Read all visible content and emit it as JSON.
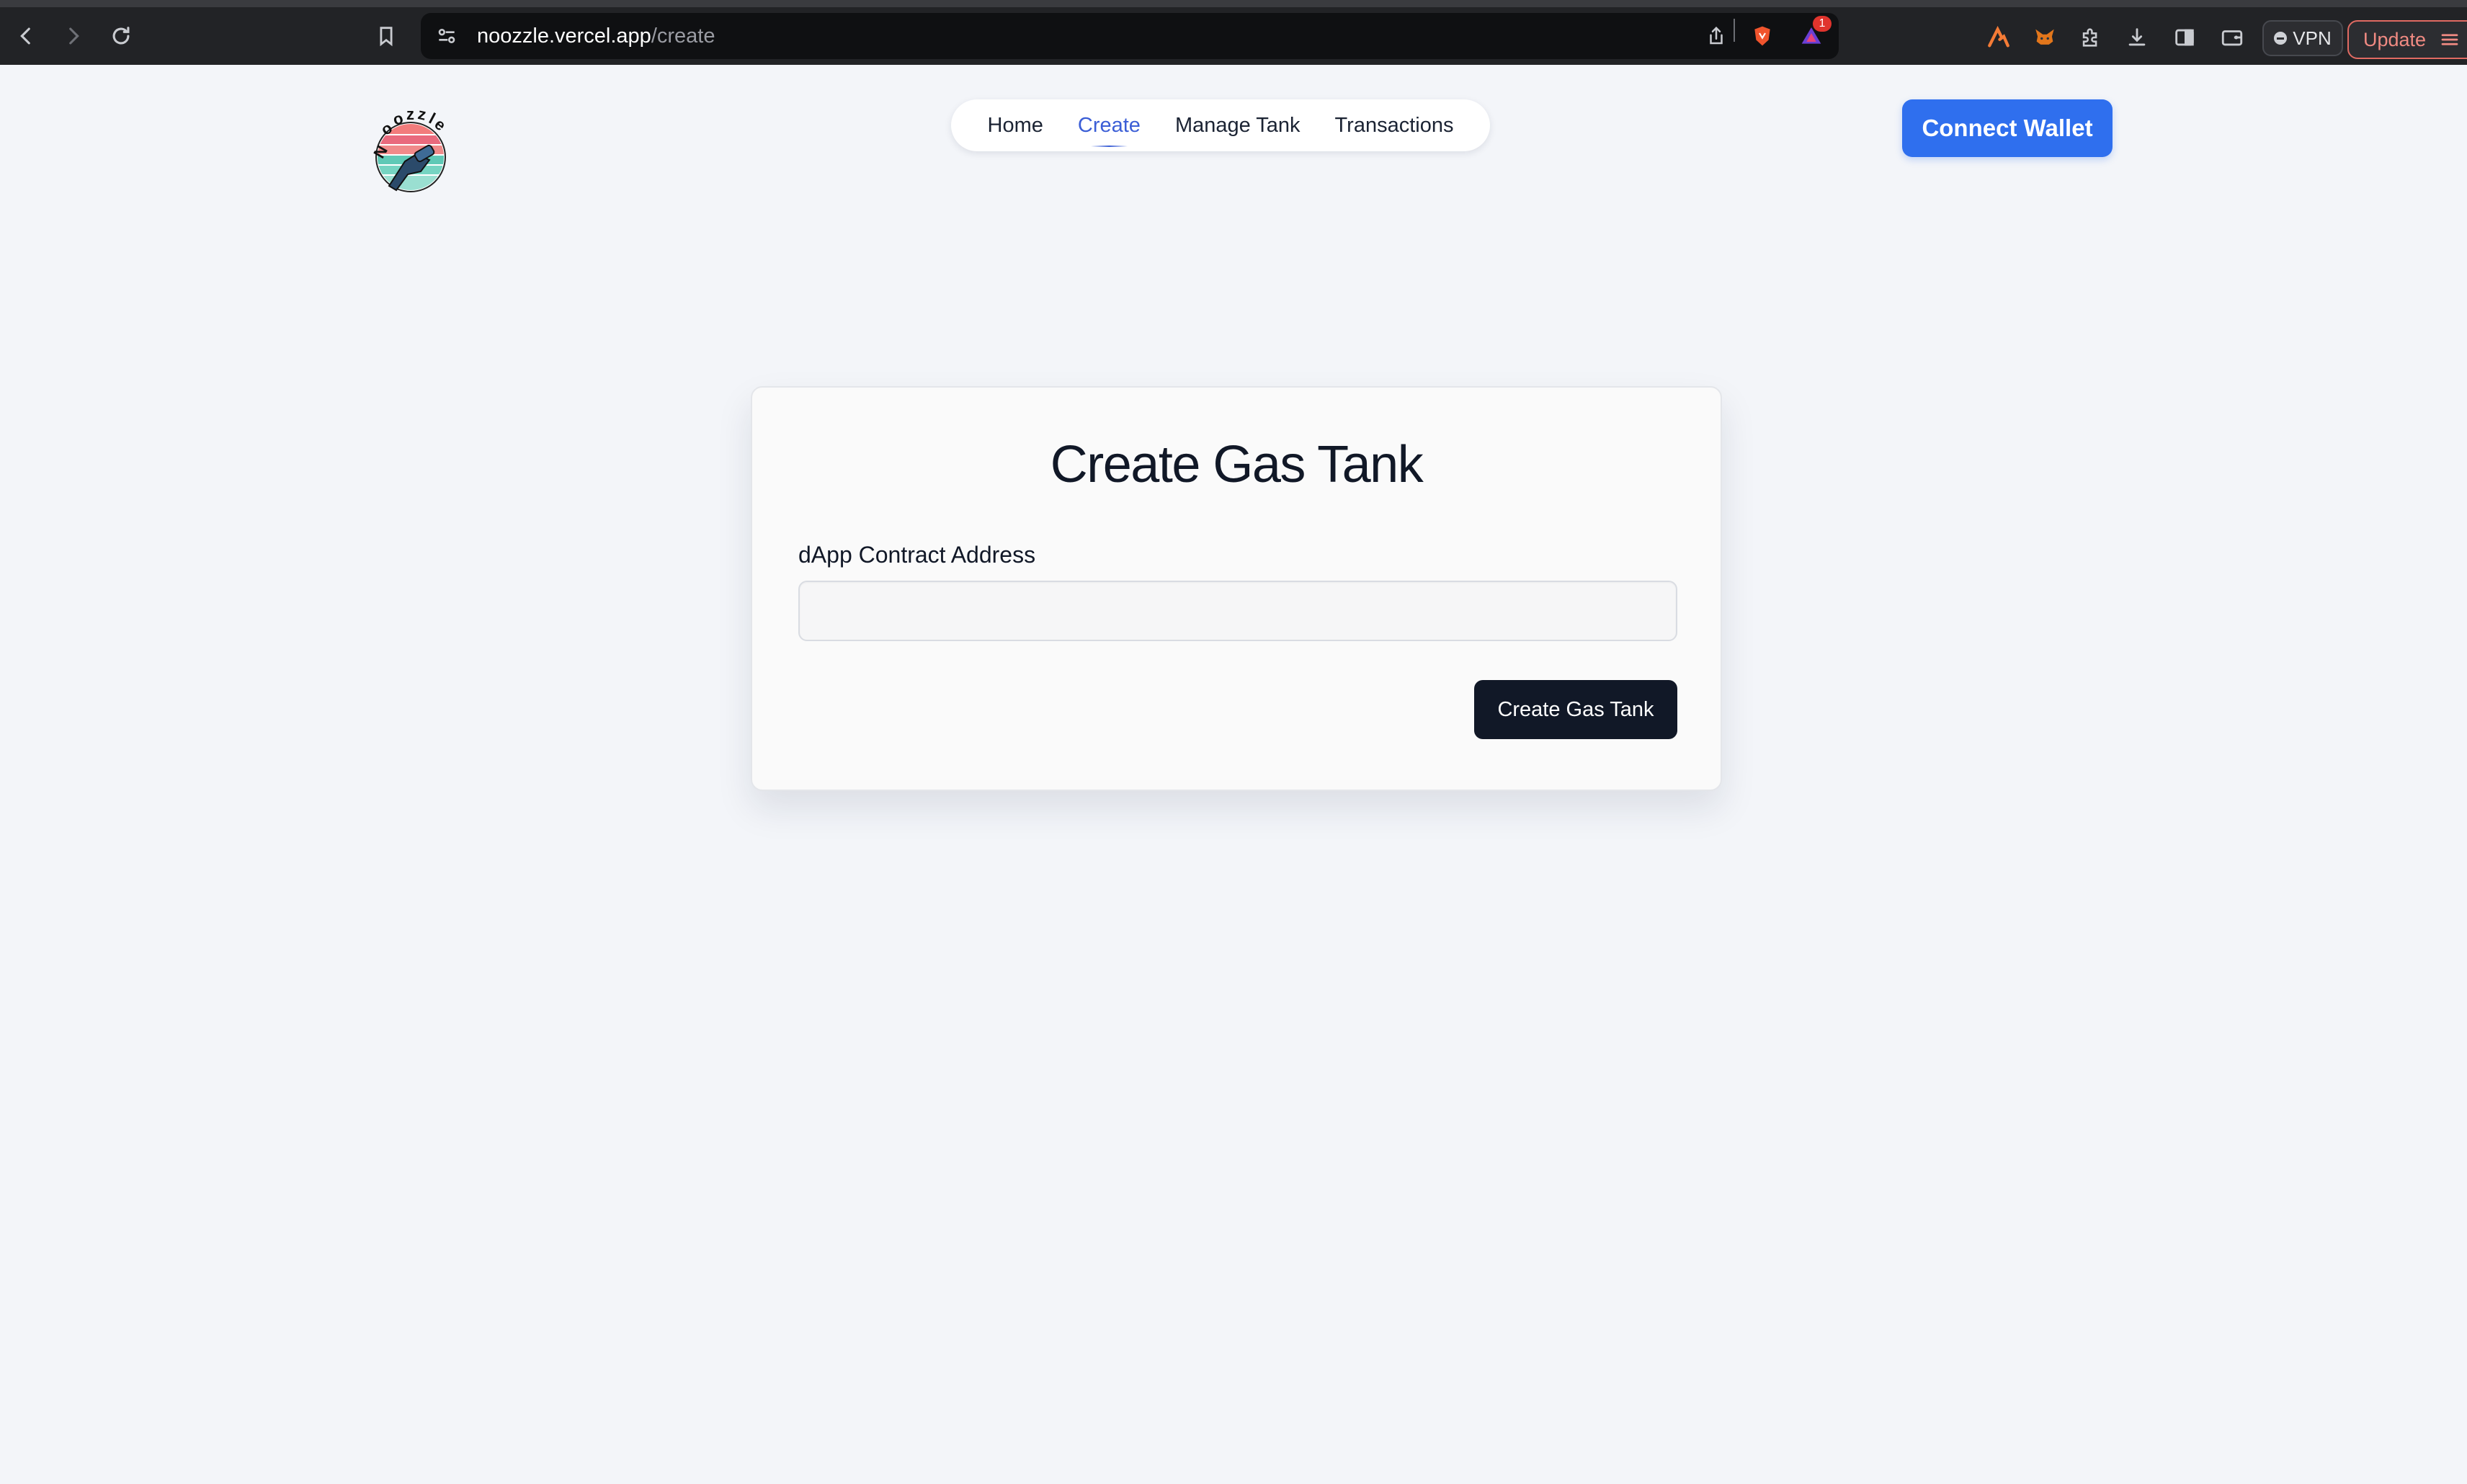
{
  "browser": {
    "url_host": "noozzle.vercel.app",
    "url_path": "/create",
    "notification_count": "1",
    "vpn_label": "VPN",
    "update_label": "Update",
    "icons": [
      "back-icon",
      "forward-icon",
      "reload-icon",
      "bookmark-icon",
      "site-settings-icon",
      "share-icon",
      "brave-shields-icon",
      "brave-rewards-icon",
      "aurora-icon",
      "metamask-icon",
      "extensions-icon",
      "download-icon",
      "sidebar-icon",
      "wallet-icon",
      "menu-icon"
    ]
  },
  "header": {
    "logo_text": "Noozzle",
    "nav": {
      "home": "Home",
      "create": "Create",
      "manage_tank": "Manage Tank",
      "transactions": "Transactions"
    },
    "active_nav": "Create",
    "connect_wallet": "Connect Wallet"
  },
  "form": {
    "title": "Create Gas Tank",
    "address_label": "dApp Contract Address",
    "address_value": "",
    "address_placeholder": "",
    "submit_label": "Create Gas Tank"
  },
  "colors": {
    "accent": "#2f6fee",
    "active_link": "#3b5ed6",
    "dark_button": "#111827",
    "page_bg": "#f3f5f9"
  }
}
